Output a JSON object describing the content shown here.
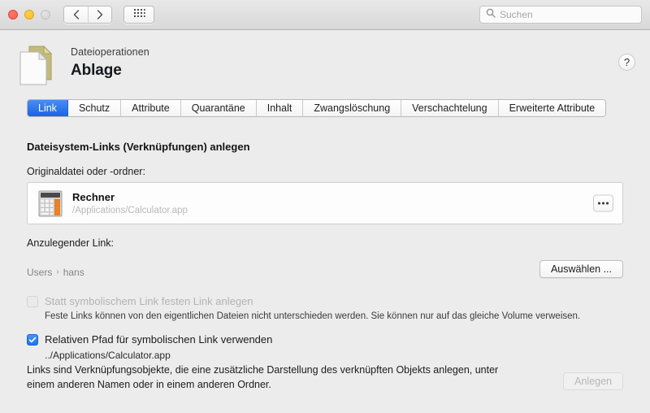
{
  "titlebar": {
    "traffic": [
      {
        "name": "close-button",
        "color": "#fb5b50"
      },
      {
        "name": "minimize-button",
        "color": "#febc2e"
      },
      {
        "name": "zoom-button",
        "color": "#d3d3d3"
      }
    ],
    "back_icon": "chevron-left-icon",
    "forward_icon": "chevron-right-icon",
    "grid_icon": "grid-dots-icon",
    "search": {
      "icon": "search-icon",
      "placeholder": "Suchen",
      "value": ""
    }
  },
  "header": {
    "icon": "document-icon",
    "subtitle": "Dateioperationen",
    "title": "Ablage",
    "help_label": "?"
  },
  "tabs": [
    {
      "label": "Link",
      "active": true
    },
    {
      "label": "Schutz",
      "active": false
    },
    {
      "label": "Attribute",
      "active": false
    },
    {
      "label": "Quarantäne",
      "active": false
    },
    {
      "label": "Inhalt",
      "active": false
    },
    {
      "label": "Zwangslöschung",
      "active": false
    },
    {
      "label": "Verschachtelung",
      "active": false
    },
    {
      "label": "Erweiterte Attribute",
      "active": false
    }
  ],
  "main": {
    "section_title": "Dateisystem-Links (Verknüpfungen) anlegen",
    "source_label": "Originaldatei oder -ordner:",
    "source_file": {
      "icon": "calculator-icon",
      "name": "Rechner",
      "path": "/Applications/Calculator.app",
      "browse_icon": "ellipsis-icon"
    },
    "target_label": "Anzulegender Link:",
    "breadcrumb": [
      "Users",
      "hans"
    ],
    "breadcrumb_separator": "›",
    "choose_button": "Auswählen ...",
    "hardlink_option": {
      "label": "Statt symbolischem Link festen Link anlegen",
      "checked": false,
      "enabled": false,
      "description": "Feste Links können von den eigentlichen Dateien nicht unterschieden werden. Sie können nur auf das gleiche Volume verweisen."
    },
    "relative_option": {
      "label": "Relativen Pfad für symbolischen Link verwenden",
      "checked": true,
      "enabled": true,
      "description": "../Applications/Calculator.app",
      "check_glyph": "✓"
    },
    "footer_text": "Links sind Verknüpfungsobjekte, die eine zusätzliche Darstellung des verknüpften Objekts anlegen, unter einem anderen Namen oder in einem anderen Ordner.",
    "create_button": "Anlegen"
  },
  "colors": {
    "accent": "#1a64e3",
    "window_bg": "#ececec",
    "titlebar_bg": "#e0e0e0",
    "field_bg": "#fdfdfd",
    "muted_text": "#b9b9b9",
    "calc_orange": "#f08020"
  }
}
